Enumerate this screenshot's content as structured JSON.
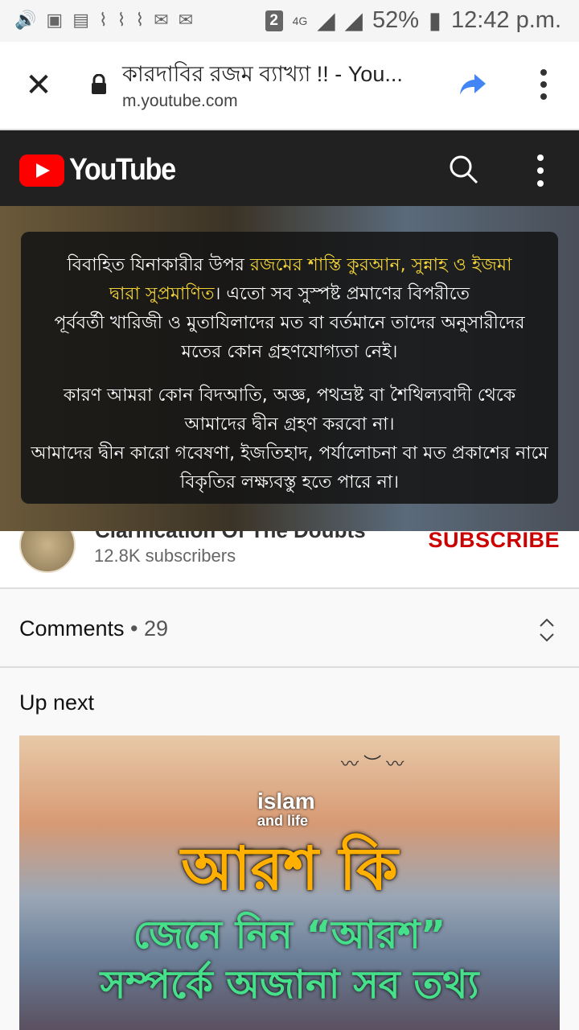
{
  "status_bar": {
    "sim_badge": "2",
    "network": "4G",
    "battery": "52%",
    "time": "12:42 p.m."
  },
  "browser": {
    "page_title": "কারদাবির রজম ব্যাখ্যা !! - You...",
    "url": "m.youtube.com"
  },
  "youtube": {
    "logo_text": "YouTube"
  },
  "video_text": {
    "line1_a": "বিবাহিত যিনাকারীর উপর ",
    "line1_hl": "রজমের শাস্তি কুরআন, সুন্নাহ ও ইজমা",
    "line2_hl": "দ্বারা সুপ্রমাণিত",
    "line2_b": "। এতো সব সুস্পষ্ট প্রমাণের বিপরীতে",
    "line3": "পূর্ববর্তী খারিজী ও মুতাযিলাদের মত বা বর্তমানে তাদের অনুসারীদের",
    "line4": "মতের কোন গ্রহণযোগ্যতা নেই।",
    "line5": "কারণ আমরা কোন বিদআতি, অজ্ঞ, পথভ্রষ্ট বা শৈথিল্যবাদী থেকে",
    "line6": "আমাদের দ্বীন গ্রহণ করবো না।",
    "line7": "আমাদের দ্বীন কারো গবেষণা, ইজতিহাদ, পর্যালোচনা বা মত প্রকাশের নামে",
    "line8": "বিকৃতির লক্ষ্যবস্তু হতে পারে না।"
  },
  "channel": {
    "name": "Clarification Of The Doubts",
    "subscribers": "12.8K subscribers",
    "subscribe_label": "SUBSCRIBE"
  },
  "comments": {
    "label": "Comments",
    "separator": " • ",
    "count": "29"
  },
  "up_next": {
    "label": "Up next",
    "thumb_brand": "islam",
    "thumb_brand_sub": "and life",
    "thumb_line1": "আরশ কি",
    "thumb_line2": "জেনে নিন “আরশ”",
    "thumb_line3": "সম্পর্কে অজানা সব তথ্য"
  }
}
